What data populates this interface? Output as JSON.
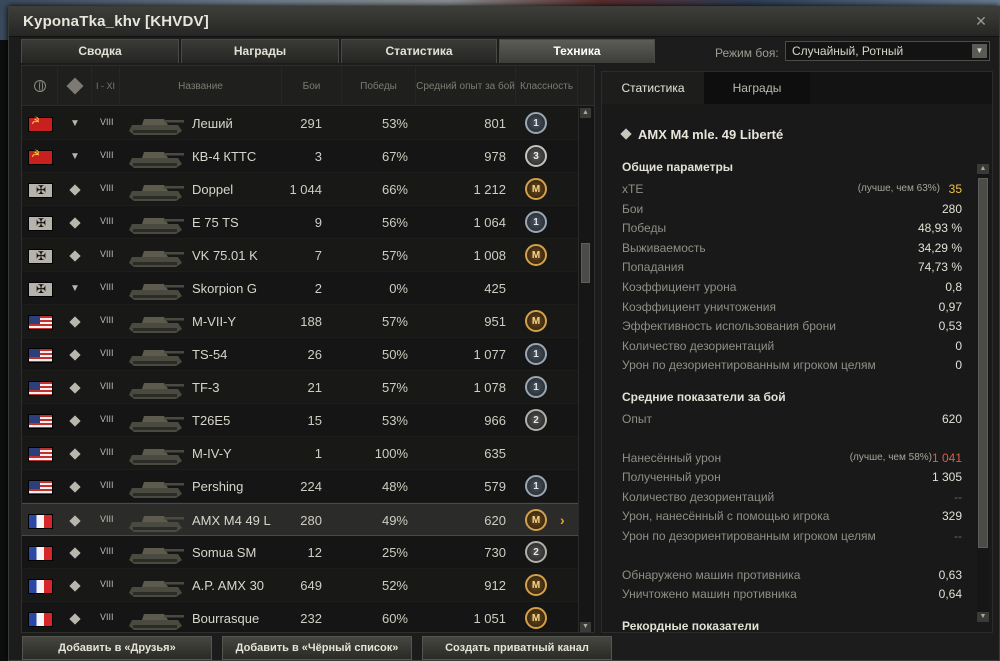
{
  "window": {
    "title": "KyponaTka_khv [KHVDV]",
    "close_glyph": "✕"
  },
  "tabs": [
    {
      "label": "Сводка",
      "active": false
    },
    {
      "label": "Награды",
      "active": false
    },
    {
      "label": "Статистика",
      "active": false
    },
    {
      "label": "Техника",
      "active": true
    }
  ],
  "battle_mode": {
    "label": "Режим боя:",
    "value": "Случайный, Ротный"
  },
  "table": {
    "headers": {
      "nation_icon": "globe-icon",
      "type_icon": "tank-type-icon",
      "tier": "I - XI",
      "name": "Название",
      "battles": "Бои",
      "wins": "Победы",
      "avg_exp": "Средний опыт за бой",
      "mastery": "Классность"
    },
    "rows": [
      {
        "nation": "ussr",
        "type": "heavy",
        "tier": "VIII",
        "name": "Леший",
        "battles": "291",
        "wins": "53%",
        "exp": "801",
        "badge": "1",
        "badge_class": "c1"
      },
      {
        "nation": "ussr",
        "type": "heavy",
        "tier": "VIII",
        "name": "КВ-4 КТТС",
        "battles": "3",
        "wins": "67%",
        "exp": "978",
        "badge": "3",
        "badge_class": "c3"
      },
      {
        "nation": "germany",
        "type": "medium",
        "tier": "VIII",
        "name": "Doppel",
        "battles": "1 044",
        "wins": "66%",
        "exp": "1 212",
        "badge": "M",
        "badge_class": "m"
      },
      {
        "nation": "germany",
        "type": "medium",
        "tier": "VIII",
        "name": "E 75 TS",
        "battles": "9",
        "wins": "56%",
        "exp": "1 064",
        "badge": "1",
        "badge_class": "c1"
      },
      {
        "nation": "germany",
        "type": "medium",
        "tier": "VIII",
        "name": "VK 75.01 K",
        "battles": "7",
        "wins": "57%",
        "exp": "1 008",
        "badge": "M",
        "badge_class": "m"
      },
      {
        "nation": "germany",
        "type": "heavy",
        "tier": "VIII",
        "name": "Skorpion G",
        "battles": "2",
        "wins": "0%",
        "exp": "425",
        "badge": "",
        "badge_class": ""
      },
      {
        "nation": "usa",
        "type": "medium",
        "tier": "VIII",
        "name": "M-VII-Y",
        "battles": "188",
        "wins": "57%",
        "exp": "951",
        "badge": "M",
        "badge_class": "m"
      },
      {
        "nation": "usa",
        "type": "medium",
        "tier": "VIII",
        "name": "TS-54",
        "battles": "26",
        "wins": "50%",
        "exp": "1 077",
        "badge": "1",
        "badge_class": "c1"
      },
      {
        "nation": "usa",
        "type": "medium",
        "tier": "VIII",
        "name": "TF-3",
        "battles": "21",
        "wins": "57%",
        "exp": "1 078",
        "badge": "1",
        "badge_class": "c1"
      },
      {
        "nation": "usa",
        "type": "medium",
        "tier": "VIII",
        "name": "T26E5",
        "battles": "15",
        "wins": "53%",
        "exp": "966",
        "badge": "2",
        "badge_class": "c2"
      },
      {
        "nation": "usa",
        "type": "medium",
        "tier": "VIII",
        "name": "M-IV-Y",
        "battles": "1",
        "wins": "100%",
        "exp": "635",
        "badge": "",
        "badge_class": ""
      },
      {
        "nation": "usa",
        "type": "medium",
        "tier": "VIII",
        "name": "Pershing",
        "battles": "224",
        "wins": "48%",
        "exp": "579",
        "badge": "1",
        "badge_class": "c1"
      },
      {
        "nation": "france",
        "type": "medium",
        "tier": "VIII",
        "name": "AMX M4 49 L",
        "battles": "280",
        "wins": "49%",
        "exp": "620",
        "badge": "M",
        "badge_class": "m",
        "selected": true
      },
      {
        "nation": "france",
        "type": "medium",
        "tier": "VIII",
        "name": "Somua SM",
        "battles": "12",
        "wins": "25%",
        "exp": "730",
        "badge": "2",
        "badge_class": "c2"
      },
      {
        "nation": "france",
        "type": "medium",
        "tier": "VIII",
        "name": "A.P. AMX 30",
        "battles": "649",
        "wins": "52%",
        "exp": "912",
        "badge": "M",
        "badge_class": "m"
      },
      {
        "nation": "france",
        "type": "medium",
        "tier": "VIII",
        "name": "Bourrasque",
        "battles": "232",
        "wins": "60%",
        "exp": "1 051",
        "badge": "M",
        "badge_class": "m"
      }
    ],
    "selected_arrow": "›"
  },
  "detail": {
    "tabs": [
      {
        "label": "Статистика"
      },
      {
        "label": "Награды"
      }
    ],
    "vehicle": "AMX M4 mle. 49 Liberté",
    "general": {
      "title": "Общие параметры",
      "items": [
        {
          "label": "xTE",
          "note": "(лучше, чем 63%)",
          "value": "35",
          "style": "gold"
        },
        {
          "label": "Бои",
          "value": "280"
        },
        {
          "label": "Победы",
          "value": "48,93 %"
        },
        {
          "label": "Выживаемость",
          "value": "34,29 %"
        },
        {
          "label": "Попадания",
          "value": "74,73 %"
        },
        {
          "label": "Коэффициент урона",
          "value": "0,8"
        },
        {
          "label": "Коэффициент уничтожения",
          "value": "0,97"
        },
        {
          "label": "Эффективность использования брони",
          "value": "0,53"
        },
        {
          "label": "Количество дезориентаций",
          "value": "0"
        },
        {
          "label": "Урон по дезориентированным игроком целям",
          "value": "0"
        }
      ]
    },
    "average": {
      "title": "Средние показатели за бой",
      "items": [
        {
          "label": "Опыт",
          "value": "620"
        },
        {
          "label": "Нанесённый урон",
          "note": "(лучше, чем 58%)",
          "value": "1 041",
          "style": "red"
        },
        {
          "label": "Полученный урон",
          "value": "1 305"
        },
        {
          "label": "Количество дезориентаций",
          "value": "--",
          "style": "dash"
        },
        {
          "label": "Урон, нанесённый с помощью игрока",
          "value": "329"
        },
        {
          "label": "Урон по дезориентированным игроком целям",
          "value": "--",
          "style": "dash"
        },
        {
          "label": "Обнаружено машин противника",
          "value": "0,63"
        },
        {
          "label": "Уничтожено машин противника",
          "value": "0,64"
        }
      ]
    },
    "records_title": "Рекордные показатели"
  },
  "bottom_buttons": [
    {
      "label": "Добавить в «Друзья»"
    },
    {
      "label": "Добавить в «Чёрный список»"
    },
    {
      "label": "Создать приватный канал"
    }
  ],
  "colors": {
    "gold": "#f0c24a",
    "red": "#e25b3c",
    "selected_arrow": "#e2a433"
  }
}
